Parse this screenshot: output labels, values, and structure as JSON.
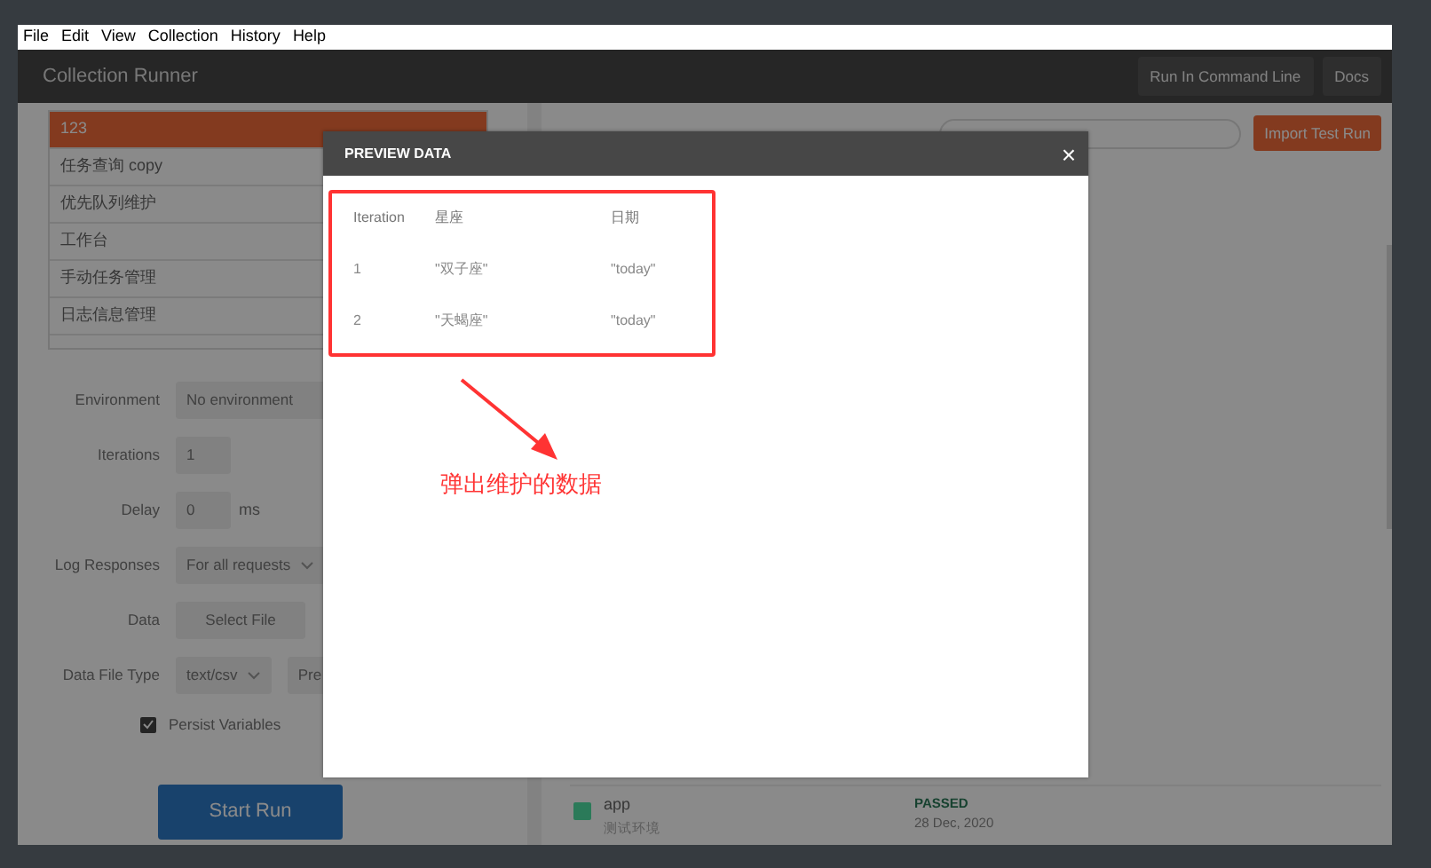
{
  "menu": [
    "File",
    "Edit",
    "View",
    "Collection",
    "History",
    "Help"
  ],
  "header": {
    "title": "Collection Runner",
    "buttons": [
      "Run In Command Line",
      "Docs"
    ]
  },
  "collections": [
    {
      "label": "123",
      "selected": true
    },
    {
      "label": "任务查询 copy",
      "selected": false
    },
    {
      "label": "优先队列维护",
      "selected": false
    },
    {
      "label": "工作台",
      "selected": false
    },
    {
      "label": "手动任务管理",
      "selected": false
    },
    {
      "label": "日志信息管理",
      "selected": false
    }
  ],
  "form": {
    "environment_label": "Environment",
    "environment": "No environment",
    "iterations_label": "Iterations",
    "iterations": "1",
    "delay_label": "Delay",
    "delay": "0",
    "delay_unit": "ms",
    "log_label": "Log Responses",
    "log": "For all requests",
    "data_label": "Data",
    "select_file": "Select File",
    "file_type_label": "Data File Type",
    "file_type": "text/csv",
    "preview": "Pre",
    "persist": {
      "label": "Persist Variables",
      "checked": true
    }
  },
  "start_button": "Start Run",
  "import_button": "Import Test Run",
  "runs": [
    {
      "name": "app",
      "environment": "测试环境",
      "status": "PASSED",
      "date": "28 Dec, 2020",
      "color": "#2b7a59"
    }
  ],
  "modal": {
    "title": "PREVIEW DATA",
    "close": "×",
    "columns": [
      "Iteration",
      "星座",
      "日期"
    ],
    "rows": [
      [
        "1",
        "\"双子座\"",
        "\"today\""
      ],
      [
        "2",
        "\"天蝎座\"",
        "\"today\""
      ]
    ],
    "annotation": "弹出维护的数据"
  }
}
